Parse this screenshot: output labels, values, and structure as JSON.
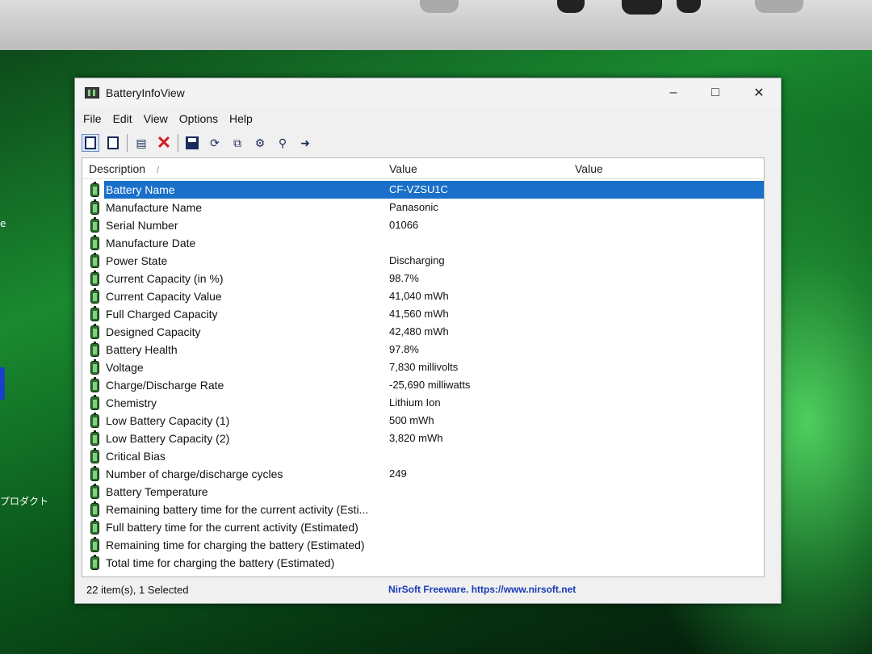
{
  "edge": {
    "left_text_1": "e",
    "left_text_2": "プロダクト"
  },
  "window": {
    "title": "BatteryInfoView",
    "controls": {
      "minimize": "–",
      "maximize": "□",
      "close": "✕"
    }
  },
  "menu": {
    "items": [
      "File",
      "Edit",
      "View",
      "Options",
      "Help"
    ]
  },
  "toolbar": {
    "buttons": [
      "view-mode-1-icon",
      "view-mode-2-icon",
      "properties-icon",
      "delete-icon",
      "save-icon",
      "refresh-icon",
      "copy-icon",
      "options-icon",
      "find-icon",
      "exit-icon"
    ]
  },
  "list": {
    "headers": {
      "description": "Description",
      "value1": "Value",
      "value2": "Value",
      "sort_indicator": "/"
    },
    "rows": [
      {
        "description": "Battery Name",
        "value": "CF-VZSU1C",
        "selected": true
      },
      {
        "description": "Manufacture Name",
        "value": "Panasonic"
      },
      {
        "description": "Serial Number",
        "value": "01066"
      },
      {
        "description": "Manufacture Date",
        "value": ""
      },
      {
        "description": "Power State",
        "value": "Discharging"
      },
      {
        "description": "Current Capacity (in %)",
        "value": "98.7%"
      },
      {
        "description": "Current Capacity Value",
        "value": "41,040 mWh"
      },
      {
        "description": "Full Charged Capacity",
        "value": "41,560 mWh"
      },
      {
        "description": "Designed Capacity",
        "value": "42,480 mWh"
      },
      {
        "description": "Battery Health",
        "value": "97.8%"
      },
      {
        "description": "Voltage",
        "value": "7,830 millivolts"
      },
      {
        "description": "Charge/Discharge Rate",
        "value": "-25,690 milliwatts"
      },
      {
        "description": "Chemistry",
        "value": "Lithium Ion"
      },
      {
        "description": "Low Battery Capacity (1)",
        "value": "500 mWh"
      },
      {
        "description": "Low Battery Capacity (2)",
        "value": "3,820 mWh"
      },
      {
        "description": "Critical Bias",
        "value": ""
      },
      {
        "description": "Number of charge/discharge cycles",
        "value": "249"
      },
      {
        "description": "Battery Temperature",
        "value": ""
      },
      {
        "description": "Remaining battery time for the current activity (Esti...",
        "value": ""
      },
      {
        "description": "Full battery time for the current activity (Estimated)",
        "value": ""
      },
      {
        "description": "Remaining time for charging the battery (Estimated)",
        "value": ""
      },
      {
        "description": "Total  time for charging the battery (Estimated)",
        "value": ""
      }
    ]
  },
  "status": {
    "count": "22 item(s), 1 Selected",
    "link": "NirSoft Freeware. https://www.nirsoft.net"
  }
}
